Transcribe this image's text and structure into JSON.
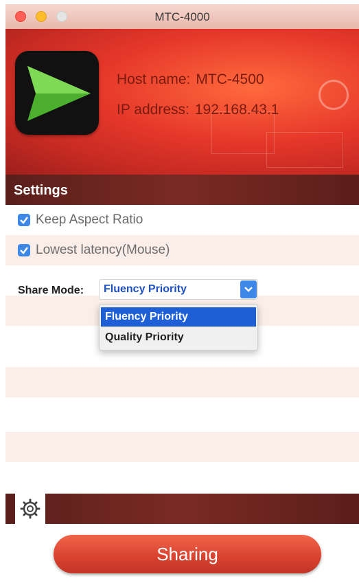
{
  "window": {
    "title": "MTC-4000"
  },
  "header": {
    "host_label": "Host name:",
    "host_value": "MTC-4500",
    "ip_label": "IP address:",
    "ip_value": "192.168.43.1"
  },
  "settings": {
    "title": "Settings",
    "keep_aspect_label": "Keep Aspect Ratio",
    "keep_aspect_checked": true,
    "lowest_latency_label": "Lowest latency(Mouse)",
    "lowest_latency_checked": true,
    "share_mode_label": "Share Mode:",
    "share_mode_value": "Fluency Priority",
    "share_mode_options": [
      "Fluency Priority",
      "Quality Priority"
    ]
  },
  "footer": {
    "button_label": "Sharing"
  },
  "colors": {
    "accent_red": "#d8412f",
    "checkbox_blue": "#3d88e6",
    "selection_blue": "#1f5fd6",
    "bar_dark": "#6a2420"
  },
  "icons": [
    "play-logo-icon",
    "film-reel-icon",
    "checkbox-checked-icon",
    "chevron-updown-icon",
    "gear-icon"
  ]
}
